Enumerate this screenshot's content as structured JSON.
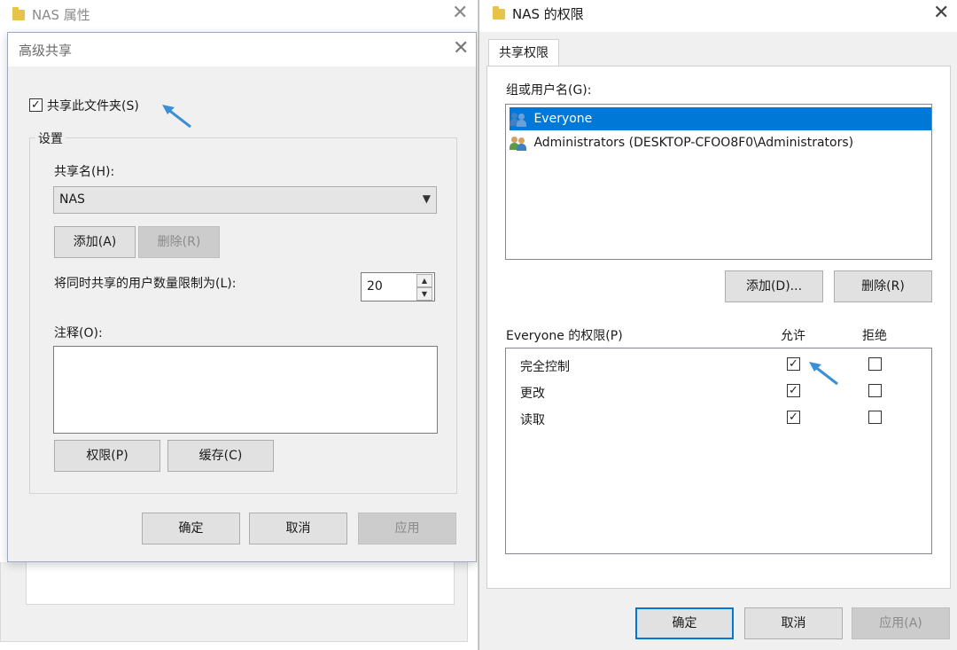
{
  "background_window": {
    "title": "NAS 属性"
  },
  "advanced_sharing": {
    "title": "高级共享",
    "share_this_folder_label": "共享此文件夹(S)",
    "share_this_folder_checked": true,
    "settings_group_label": "设置",
    "share_name_label": "共享名(H):",
    "share_name_value": "NAS",
    "add_button": "添加(A)",
    "remove_button": "删除(R)",
    "user_limit_label": "将同时共享的用户数量限制为(L):",
    "user_limit_value": "20",
    "comment_label": "注释(O):",
    "comment_value": "",
    "permissions_button": "权限(P)",
    "caching_button": "缓存(C)",
    "ok_button": "确定",
    "cancel_button": "取消",
    "apply_button": "应用"
  },
  "permissions_dialog": {
    "title": "NAS 的权限",
    "tab_label": "共享权限",
    "group_label": "组或用户名(G):",
    "users": [
      {
        "name": "Everyone",
        "selected": true
      },
      {
        "name": "Administrators (DESKTOP-CFOO8F0\\Administrators)",
        "selected": false
      }
    ],
    "add_button": "添加(D)...",
    "remove_button": "删除(R)",
    "permissions_for_label": "Everyone 的权限(P)",
    "allow_header": "允许",
    "deny_header": "拒绝",
    "permissions": [
      {
        "name": "完全控制",
        "allow": true,
        "deny": false
      },
      {
        "name": "更改",
        "allow": true,
        "deny": false
      },
      {
        "name": "读取",
        "allow": true,
        "deny": false
      }
    ],
    "ok_button": "确定",
    "cancel_button": "取消",
    "apply_button": "应用(A)"
  },
  "colors": {
    "selection": "#0078d7",
    "annotation_arrow": "#3a8fd6",
    "folder": "#e8c34a"
  },
  "icons": [
    "folder-icon",
    "close-icon",
    "chevron-down-icon",
    "user-group-icon",
    "checkmark-icon",
    "annotation-arrow-icon"
  ]
}
